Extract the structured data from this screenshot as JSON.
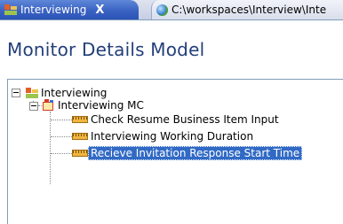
{
  "tabs": [
    {
      "label": "Interviewing",
      "icon": "monitor-model-icon",
      "active": true,
      "close": "X"
    },
    {
      "label": "C:\\workspaces\\Interview\\Inte",
      "icon": "globe-icon",
      "active": false
    }
  ],
  "page": {
    "title": "Monitor Details Model"
  },
  "tree": {
    "root": {
      "label": "Interviewing",
      "icon": "monitor-model-icon",
      "expanded": true
    },
    "mc": {
      "label": "Interviewing MC",
      "icon": "monitoring-context-icon",
      "expanded": true
    },
    "items": [
      {
        "label": "Check Resume Business Item Input",
        "icon": "metric-icon",
        "selected": false
      },
      {
        "label": "Interviewing Working Duration",
        "icon": "metric-icon",
        "selected": false
      },
      {
        "label": "Recieve Invitation Response Start Time",
        "icon": "metric-icon",
        "selected": true
      }
    ]
  },
  "colors": {
    "title": "#233f7a",
    "selection": "#316ac5",
    "active_tab": "#3a62c2"
  }
}
